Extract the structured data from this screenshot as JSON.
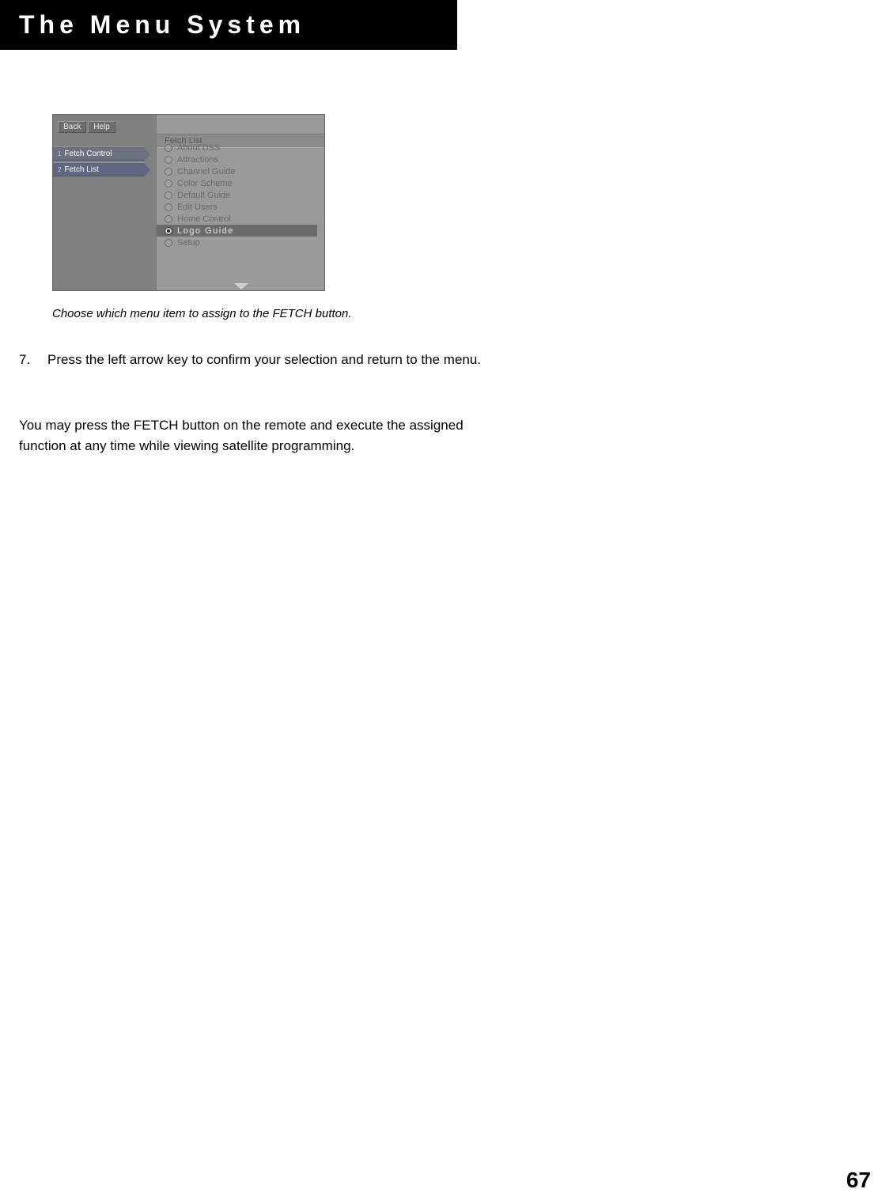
{
  "header": {
    "title": "The Menu System"
  },
  "tv": {
    "toolbar": {
      "back": "Back",
      "help": "Help"
    },
    "tabs": [
      {
        "num": "1",
        "label": "Fetch Control"
      },
      {
        "num": "2",
        "label": "Fetch List"
      }
    ],
    "panel_title": "Fetch List",
    "options": [
      {
        "label": "About DSS",
        "selected": false
      },
      {
        "label": "Attractions",
        "selected": false
      },
      {
        "label": "Channel Guide",
        "selected": false
      },
      {
        "label": "Color Scheme",
        "selected": false
      },
      {
        "label": "Default Guide",
        "selected": false
      },
      {
        "label": "Edit Users",
        "selected": false
      },
      {
        "label": "Home Control",
        "selected": false
      },
      {
        "label": "Logo Guide",
        "selected": true
      },
      {
        "label": "Setup",
        "selected": false
      }
    ]
  },
  "caption": "Choose which menu item to assign to the FETCH button.",
  "step": {
    "num": "7.",
    "text": "Press the left arrow key to confirm your selection and return to the menu."
  },
  "paragraph": "You may press the FETCH button on the remote and execute the assigned function at any time while viewing satellite programming.",
  "page_number": "67"
}
